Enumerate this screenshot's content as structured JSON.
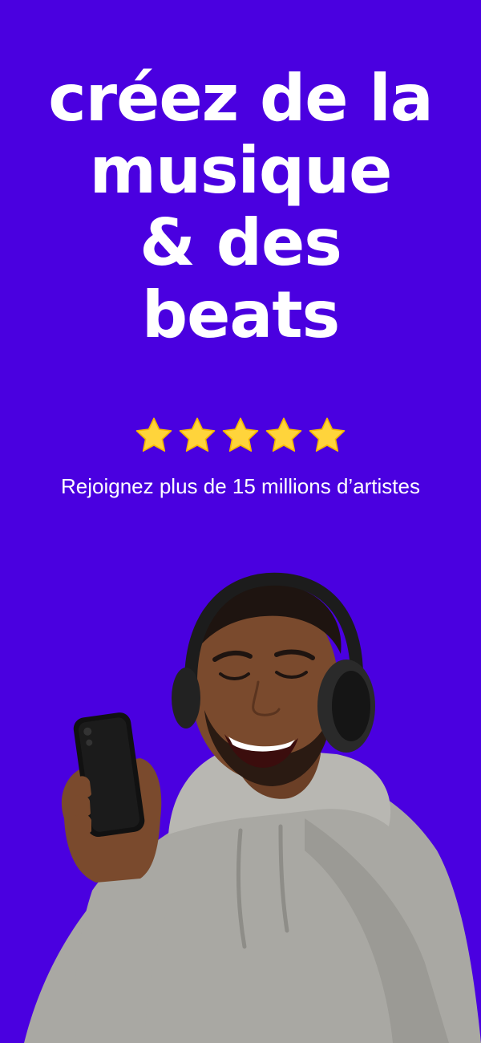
{
  "headline": {
    "lines": [
      "créez de la",
      "musique",
      "& des",
      "beats"
    ]
  },
  "rating": {
    "stars": 5,
    "max": 5,
    "color": "#ffd43b"
  },
  "tagline": "Rejoignez plus de 15 millions d’artistes",
  "hero": {
    "icon": "man-with-headphones-and-phone"
  },
  "colors": {
    "background": "#4a00e0",
    "text": "#ffffff"
  }
}
